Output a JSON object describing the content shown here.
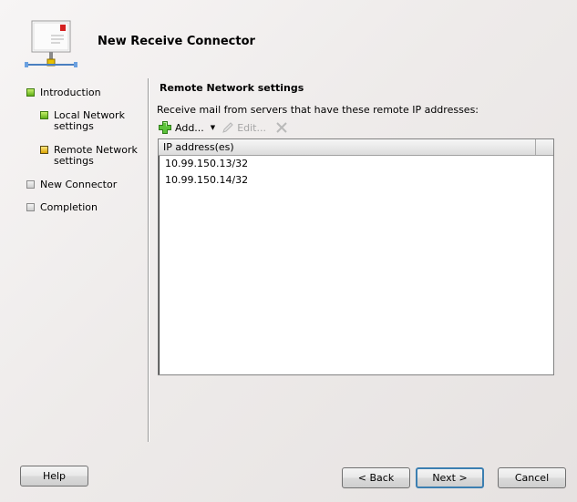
{
  "wizard": {
    "title": "New Receive Connector",
    "icon": "mail-connector-icon"
  },
  "nav": {
    "items": [
      {
        "label": "Introduction",
        "status": "complete",
        "color": "#7ccd2a"
      },
      {
        "label": "Local Network\nsettings",
        "status": "complete",
        "color": "#7ccd2a"
      },
      {
        "label": "Remote Network\nsettings",
        "status": "current",
        "color": "#e8b400"
      },
      {
        "label": "New Connector",
        "status": "pending",
        "color": "#d9d9d9"
      },
      {
        "label": "Completion",
        "status": "pending",
        "color": "#d9d9d9"
      }
    ]
  },
  "main": {
    "section_title": "Remote Network settings",
    "description": "Receive mail from servers that have these remote IP addresses:",
    "toolbar": {
      "add_label": "Add...",
      "edit_label": "Edit...",
      "add_icon": "green-plus-icon",
      "edit_icon": "pencil-icon",
      "remove_icon": "red-x-icon"
    },
    "list": {
      "column_header": "IP address(es)",
      "rows": [
        "10.99.150.13/32",
        "10.99.150.14/32"
      ]
    }
  },
  "buttons": {
    "help": "Help",
    "back": "< Back",
    "next": "Next >",
    "cancel": "Cancel"
  }
}
